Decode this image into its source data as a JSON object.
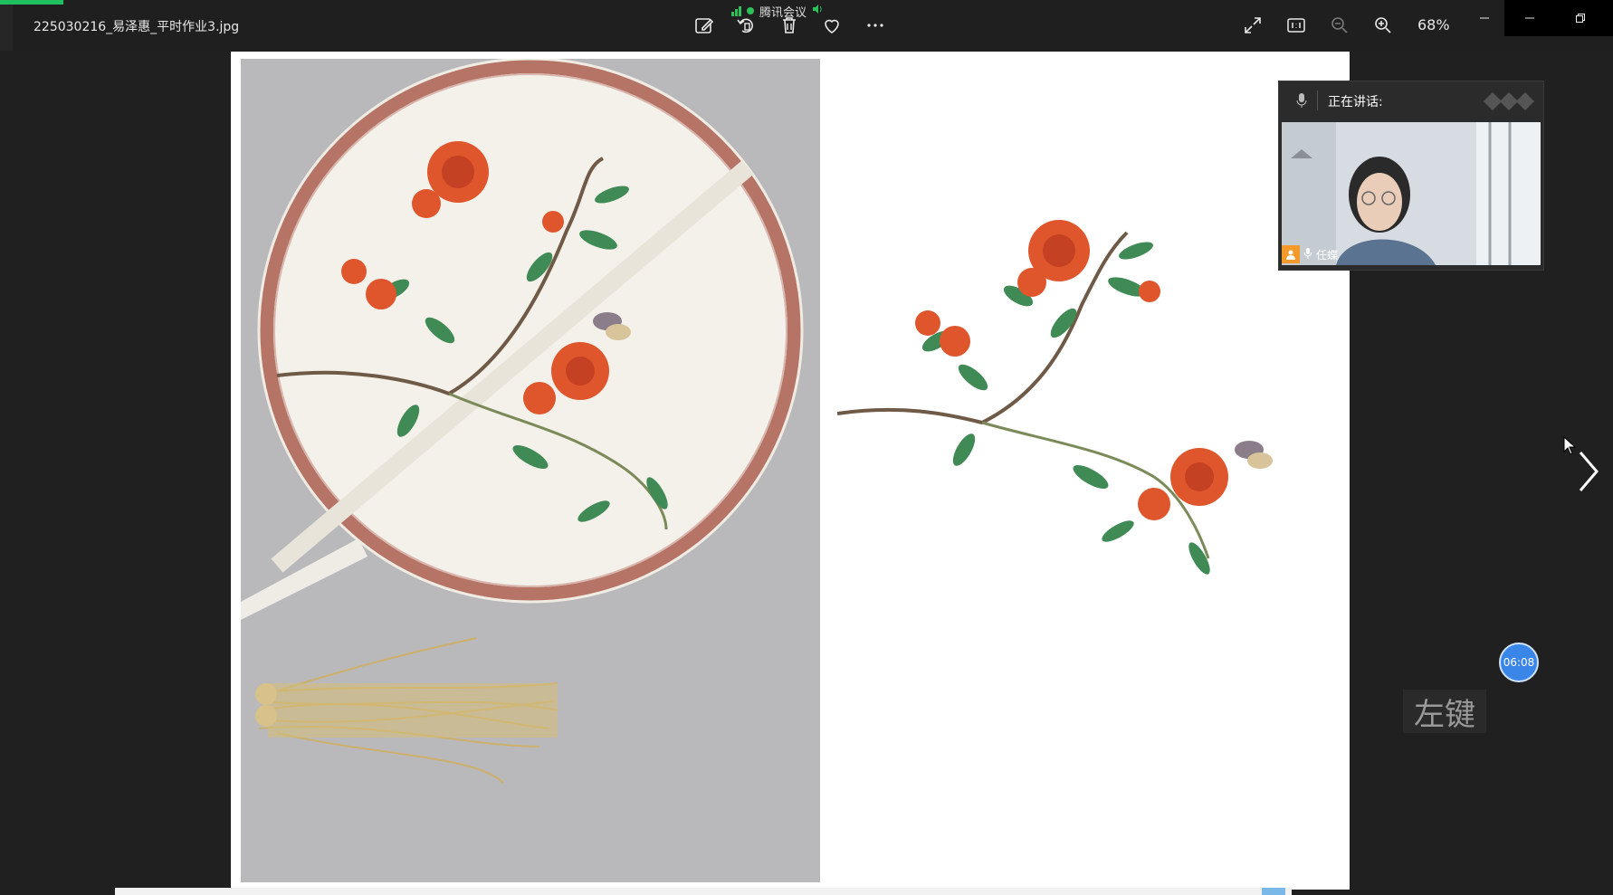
{
  "titlebar": {
    "file_name": "225030216_易泽惠_平时作业3.jpg",
    "zoom": "68%",
    "icons": [
      "edit-icon",
      "rotate-icon",
      "delete-icon",
      "favorite-icon",
      "more-icon",
      "fullscreen-icon",
      "actual-size-icon",
      "zoom-out-icon",
      "zoom-in-icon"
    ],
    "window_controls": [
      "minimize",
      "restore",
      "close"
    ]
  },
  "meeting": {
    "app_name": "腾讯会议",
    "speaking_label": "正在讲话:",
    "participant_name": "任蝶",
    "timer": "06:08"
  },
  "keyhint": {
    "text": "左键"
  },
  "colors": {
    "background": "#202020",
    "accent_green": "#1fbf5f",
    "timer_blue": "#3a85e8",
    "petal_orange": "#e0562c",
    "leaf_green": "#3f8a55"
  }
}
